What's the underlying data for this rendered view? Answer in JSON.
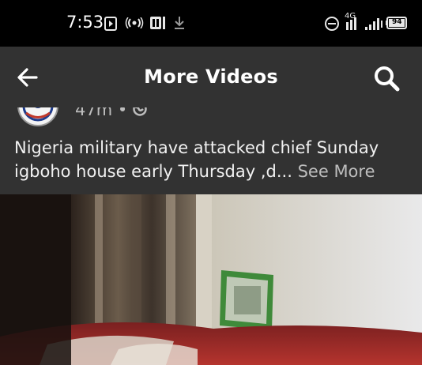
{
  "status_bar": {
    "time": "7:53",
    "battery": "94",
    "network": "4G"
  },
  "header": {
    "title": "More Videos",
    "back_icon": "arrow-left-icon",
    "search_icon": "search-icon"
  },
  "post": {
    "time_ago": "47m",
    "separator": "•",
    "text": "Nigeria military have attacked chief Sunday igboho house early Thursday ,d",
    "ellipsis": "...",
    "see_more_label": "See More"
  },
  "colors": {
    "status_bar_bg": "#000000",
    "header_bg": "#323232",
    "text": "#ffffff",
    "secondary_text": "#bdbdbd"
  }
}
